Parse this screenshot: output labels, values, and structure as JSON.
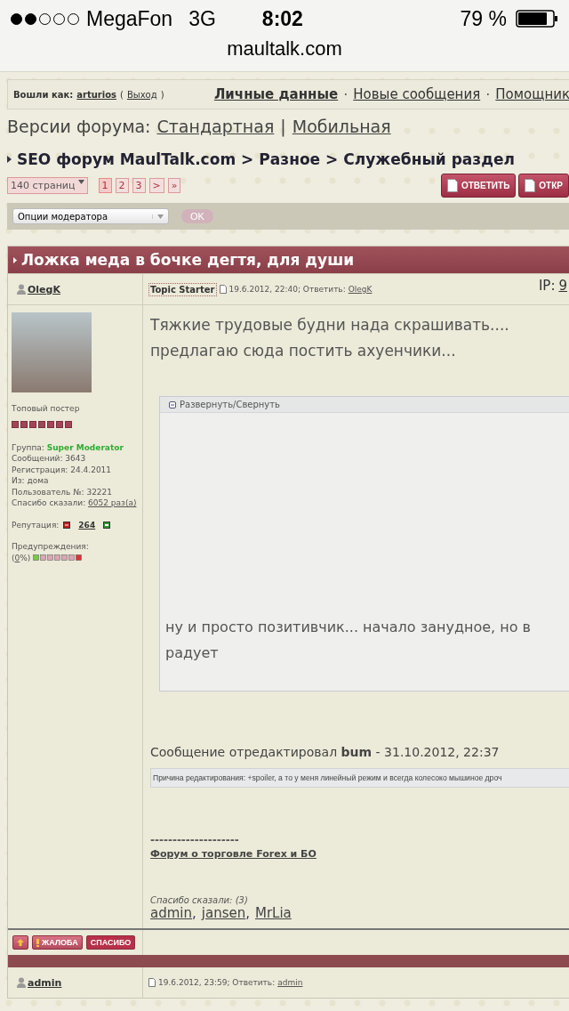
{
  "status_bar": {
    "carrier": "MegaFon",
    "network": "3G",
    "time": "8:02",
    "battery": "79 %"
  },
  "address_bar": {
    "url": "maultalk.com"
  },
  "login_bar": {
    "label": "Вошли как:",
    "username": "arturios",
    "paren_open": "(",
    "logout": "Выход",
    "paren_close": ")"
  },
  "nav_links": [
    {
      "label": "Личные данные",
      "selected": true
    },
    {
      "label": "Новые сообщения",
      "selected": false
    },
    {
      "label": "Помощник",
      "selected": false
    }
  ],
  "nav_separator": "·",
  "versions": {
    "label": "Версии форума:",
    "separator": "|",
    "links": [
      "Стандартная",
      "Мобильная"
    ]
  },
  "breadcrumb": {
    "items": [
      "SEO форум MaulTalk.com",
      "Разное",
      "Служебный раздел"
    ],
    "separator": ">"
  },
  "pagination": {
    "dropdown": "140 страниц",
    "pages": [
      {
        "label": "1",
        "selected": true
      },
      {
        "label": "2",
        "selected": false
      },
      {
        "label": "3",
        "selected": false
      },
      {
        "label": ">",
        "selected": false
      },
      {
        "label": "»",
        "selected": false
      }
    ]
  },
  "actions": [
    "ОТВЕТИТЬ",
    "ОТКР"
  ],
  "moderator": {
    "select": "Опции модератора",
    "button": "OK"
  },
  "topic_title": "Ложка меда в бочке дегтя, для души",
  "post": {
    "author": "OlegK",
    "badge": "Topic Starter",
    "date": "19.6.2012, 22:40; Ответить:",
    "reply_to": "OlegK",
    "ip_label": "IP:",
    "ip_value": "9",
    "profile": {
      "rank": "Топовый постер",
      "stars": 7,
      "info": [
        {
          "label": "Группа:",
          "value": "Super Moderator",
          "kind": "group"
        },
        {
          "label": "Сообщений:",
          "value": "3643",
          "kind": "plain"
        },
        {
          "label": "Регистрация:",
          "value": "24.4.2011",
          "kind": "plain"
        },
        {
          "label": "Из:",
          "value": "дома",
          "kind": "plain"
        },
        {
          "label": "Пользователь №:",
          "value": "32221",
          "kind": "plain"
        },
        {
          "label": "Спасибо сказали:",
          "value": "6052 раз(а)",
          "kind": "link"
        }
      ],
      "reputation_label": "Репутация:",
      "reputation": "264",
      "warnings_label": "Предупреждения:",
      "warnings_open": "(",
      "warnings_value": "0",
      "warnings_close": "%)"
    },
    "body": [
      "Тяжкие трудовые будни нада скрашивать....",
      "предлагаю сюда постить ахуенчики..."
    ],
    "spoiler": {
      "title": "Развернуть/Свернуть",
      "expanded": true,
      "text": [
        "ну и просто позитивчик... начало занудное, но в",
        "радует"
      ]
    },
    "edited": "Сообщение отредактировал **bum** - 31.10.2012, 22:37",
    "edit_reason": "Причина редактирования: +spoiler, а то у меня линейный режим и всегда колесоко мышиное дроч",
    "signature_rule": "--------------------",
    "signature_link": "Форум о торговле Forex и БО",
    "thanks_label": "Спасибо сказали: (3)",
    "thanks_users": [
      "admin",
      "jansen",
      "MrLia"
    ],
    "thanks_separator": ",",
    "buttons": [
      {
        "kind": "up"
      },
      {
        "kind": "report",
        "label": "ЖАЛОБА"
      },
      {
        "kind": "thanks",
        "label": "СПАСИБО"
      }
    ]
  },
  "next_post": {
    "author": "admin",
    "date": "19.6.2012, 23:59; Ответить:",
    "reply_to": "admin"
  }
}
